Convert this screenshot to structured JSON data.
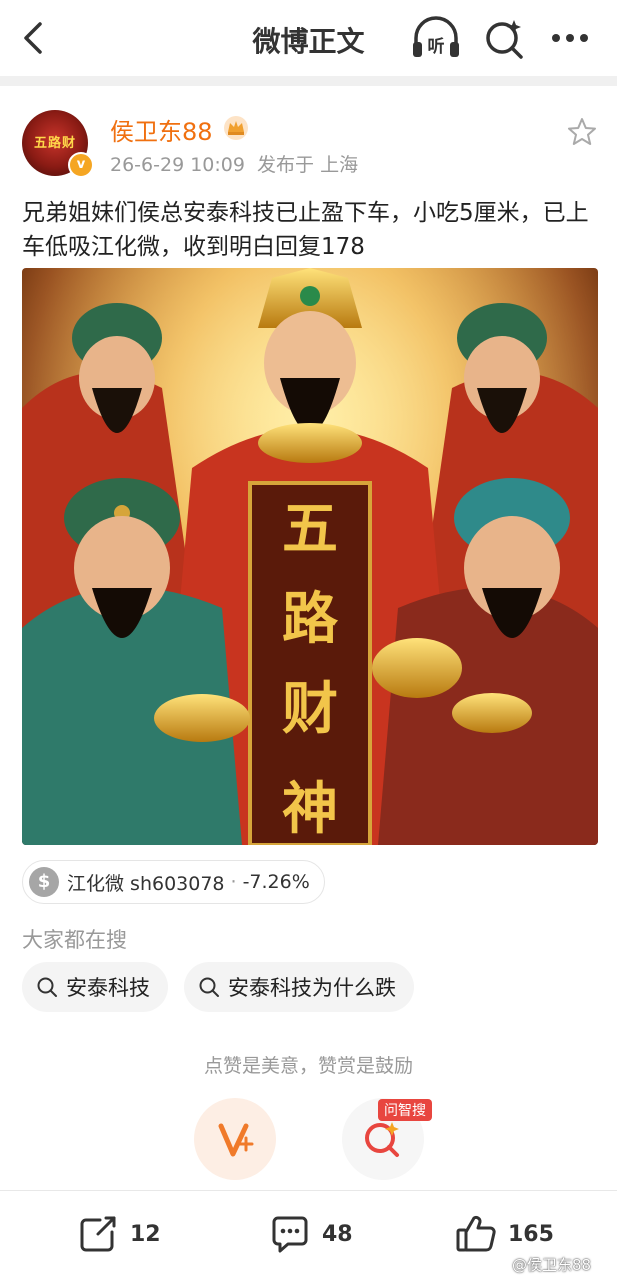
{
  "header": {
    "title": "微博正文",
    "listen_label": "听"
  },
  "post": {
    "author": "侯卫东88",
    "avatar_text": "五路财",
    "verified_badge": "v",
    "time": "26-6-29 10:09",
    "source": "发布于 上海",
    "text": "兄弟姐妹们侯总安泰科技已止盈下车，小吃5厘米，已上车低吸江化微，收到明白回复178",
    "image_alt": "五路财神"
  },
  "stock": {
    "icon": "$",
    "name": "江化微 sh603078",
    "separator": "·",
    "change": "-7.26%"
  },
  "search": {
    "heading": "大家都在搜",
    "chips": [
      "安泰科技",
      "安泰科技为什么跌"
    ]
  },
  "reward": {
    "text": "点赞是美意，赞赏是鼓励",
    "ask_badge": "问智搜"
  },
  "actions": {
    "repost_count": "12",
    "comment_count": "48",
    "like_count": "165"
  },
  "watermark": "@侯卫东88",
  "colors": {
    "accent": "#f07010",
    "badge": "#f5a623",
    "red": "#e8463f"
  }
}
